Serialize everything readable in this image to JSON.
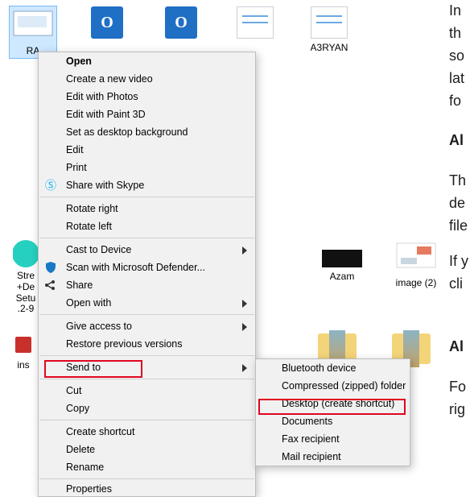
{
  "files_row1": [
    {
      "label": "RA"
    },
    {
      "label": ""
    },
    {
      "label": ""
    },
    {
      "label": ""
    },
    {
      "label": "A3RYAN"
    }
  ],
  "files_row2": {
    "left_label_lines": [
      "Stre",
      "+De",
      "Setu",
      ".2-9"
    ],
    "azam": "Azam",
    "image2": "image (2)"
  },
  "files_row3": {
    "left_label": "ins"
  },
  "context_menu": {
    "open": "Open",
    "create_video": "Create a new video",
    "edit_photos": "Edit with Photos",
    "edit_paint3d": "Edit with Paint 3D",
    "set_bg": "Set as desktop background",
    "edit": "Edit",
    "print": "Print",
    "share_skype": "Share with Skype",
    "rotate_right": "Rotate right",
    "rotate_left": "Rotate left",
    "cast": "Cast to Device",
    "scan_defender": "Scan with Microsoft Defender...",
    "share": "Share",
    "open_with": "Open with",
    "give_access": "Give access to",
    "restore_prev": "Restore previous versions",
    "send_to": "Send to",
    "cut": "Cut",
    "copy": "Copy",
    "create_shortcut": "Create shortcut",
    "delete": "Delete",
    "rename": "Rename",
    "properties": "Properties"
  },
  "send_to_menu": {
    "bluetooth": "Bluetooth device",
    "compressed": "Compressed (zipped) folder",
    "desktop_shortcut": "Desktop (create shortcut)",
    "documents": "Documents",
    "fax": "Fax recipient",
    "mail": "Mail recipient"
  },
  "right_text": {
    "l1": "In",
    "l2": "th",
    "l3": "so",
    "l4": "lat",
    "l5": "fo",
    "h1": "Al",
    "l6": "Th",
    "l7": "de",
    "l8": "file",
    "l9": "If y",
    "l10": "cli",
    "h2": "Al",
    "l11": "Fo",
    "l12": "rig"
  }
}
